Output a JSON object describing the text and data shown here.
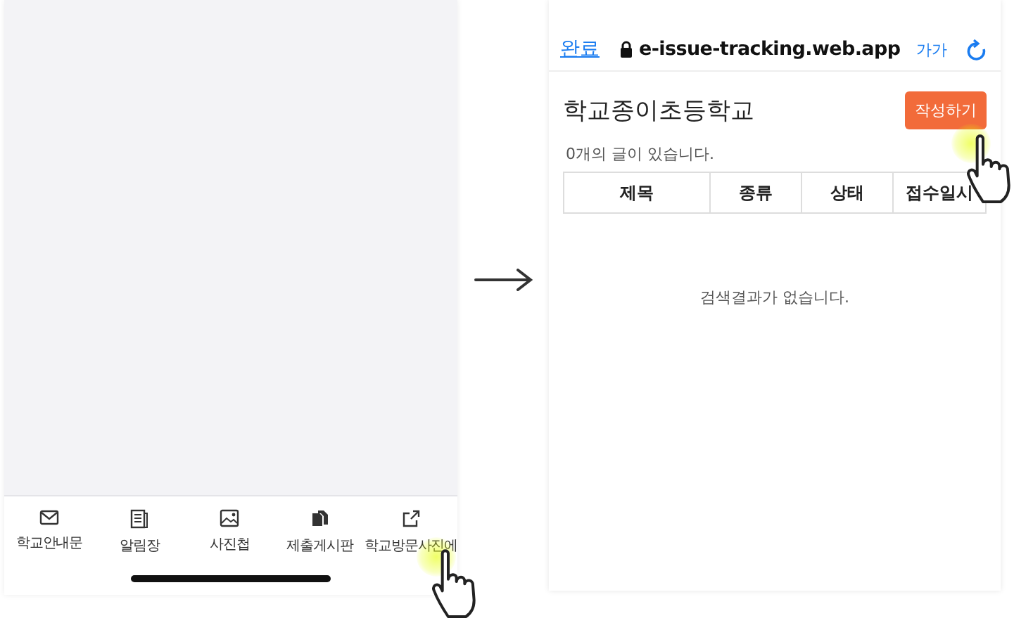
{
  "left_screen": {
    "tab_bar": [
      {
        "label": "학교안내문",
        "kind": "mail"
      },
      {
        "label": "알림장",
        "kind": "notebook"
      },
      {
        "label": "사진첩",
        "kind": "image"
      },
      {
        "label": "제출게시판",
        "kind": "files"
      },
      {
        "label": "학교방문사진에",
        "kind": "external"
      }
    ]
  },
  "right_screen": {
    "browser_bar": {
      "done": "완료",
      "url": "e-issue-tracking.web.app",
      "text_size": "가가"
    },
    "title": "학교종이초등학교",
    "write_button": "작성하기",
    "count": "0개의 글이 있습니다.",
    "table": {
      "columns": [
        "제목",
        "종류",
        "상태",
        "접수일시"
      ],
      "empty_message": "검색결과가 없습니다."
    }
  }
}
